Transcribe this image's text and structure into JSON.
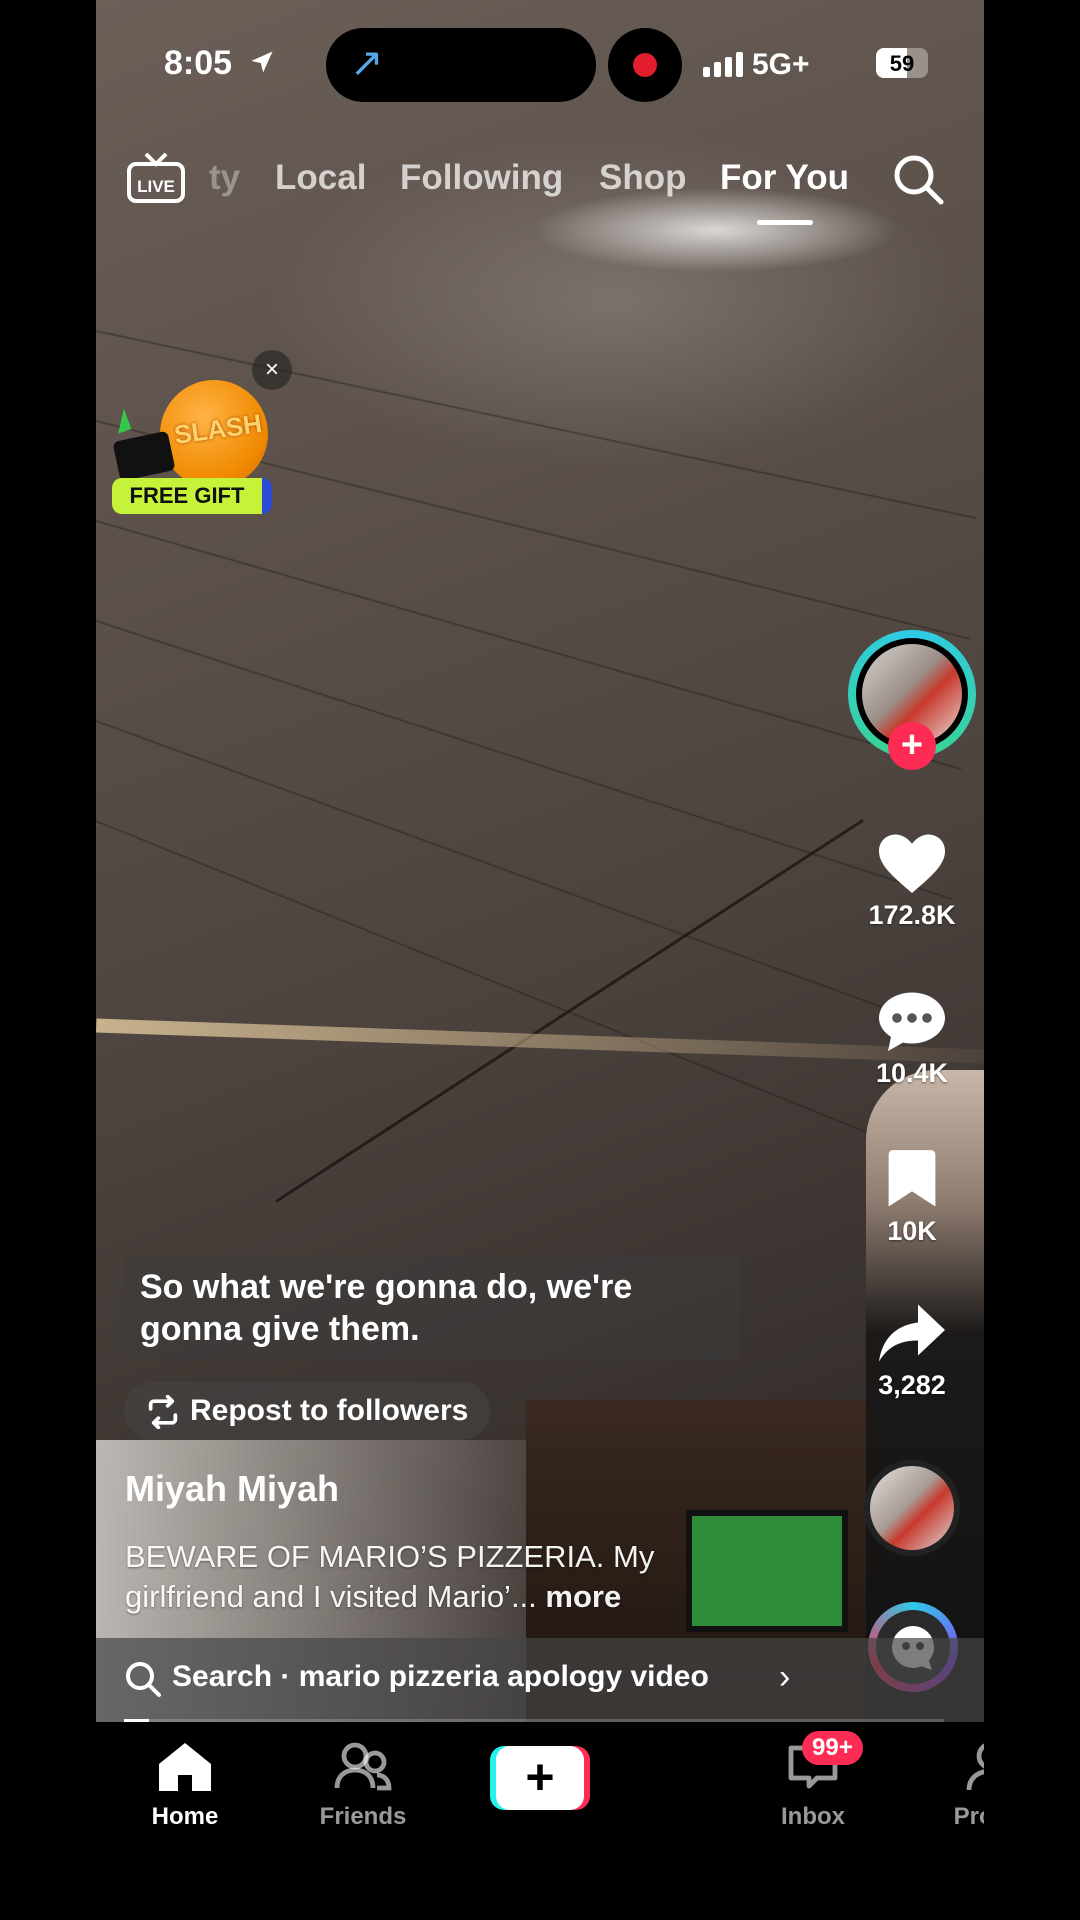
{
  "status_bar": {
    "time": "8:05",
    "network": "5G+",
    "battery": "59",
    "battery_level": 0.59,
    "signal_bars": 4,
    "location_icon": "location-arrow-icon",
    "island_icon": "return-arrow-icon",
    "recording_icon": "record-dot-icon"
  },
  "top_nav": {
    "live_label": "LIVE",
    "partial_tab": "ty",
    "tabs": [
      {
        "label": "Local"
      },
      {
        "label": "Following"
      },
      {
        "label": "Shop"
      },
      {
        "label": "For You"
      }
    ],
    "active_tab": "For You",
    "search_icon": "search-icon"
  },
  "promo": {
    "brand_text": "SLASH",
    "gift_label": "FREE GIFT",
    "close": "×"
  },
  "sidebar": {
    "follow": "+",
    "like_count": "172.8K",
    "comment_count": "10.4K",
    "save_count": "10K",
    "share_count": "3,282"
  },
  "video": {
    "caption": "So what we're gonna do, we're gonna give them.",
    "repost_label": "Repost to followers",
    "username": "Miyah Miyah",
    "description": "BEWARE OF MARIO’S PIZZERIA. My girlfriend and I visited Mario’...",
    "more_label": " more",
    "search_suggestion": "Search · mario pizzeria apology video",
    "search_chevron": "›",
    "progress": 0.03
  },
  "bottom_nav": {
    "home": "Home",
    "friends": "Friends",
    "create": "+",
    "inbox": "Inbox",
    "inbox_badge": "99+",
    "profile": "Profile"
  },
  "colors": {
    "accent": "#fe2c55",
    "cyan": "#25f4ee",
    "ring": "#2ecbe8"
  }
}
